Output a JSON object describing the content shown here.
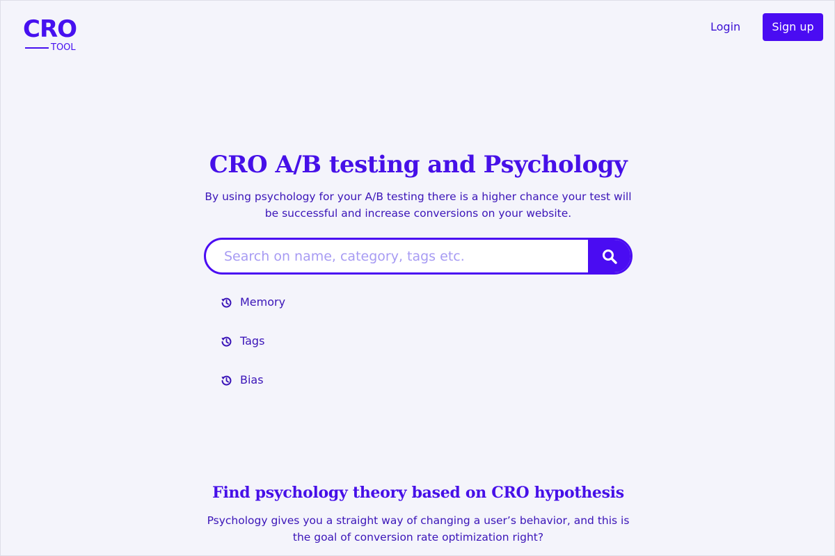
{
  "logo": {
    "top": "CRO",
    "bottom": "TOOL"
  },
  "nav": {
    "login": "Login",
    "signup": "Sign up"
  },
  "hero": {
    "title": "CRO A/B testing and Psychology",
    "subtitle": "By using psychology for your A/B testing there is a higher chance your test will be successful and increase conversions on your website."
  },
  "search": {
    "placeholder": "Search on name, category, tags etc.",
    "value": "",
    "button_icon": "search-icon"
  },
  "recent_searches": [
    {
      "label": "Memory",
      "icon": "history-icon"
    },
    {
      "label": "Tags",
      "icon": "history-icon"
    },
    {
      "label": "Bias",
      "icon": "history-icon"
    }
  ],
  "section": {
    "title": "Find psychology theory based on CRO hypothesis",
    "subtitle": "Psychology gives you a straight way of changing a user’s behavior, and this is the goal of conversion rate optimization right?"
  },
  "colors": {
    "accent": "#4a0cf2",
    "background": "#f4f4fb",
    "text": "#3a14b8",
    "placeholder": "#a79bf3"
  }
}
